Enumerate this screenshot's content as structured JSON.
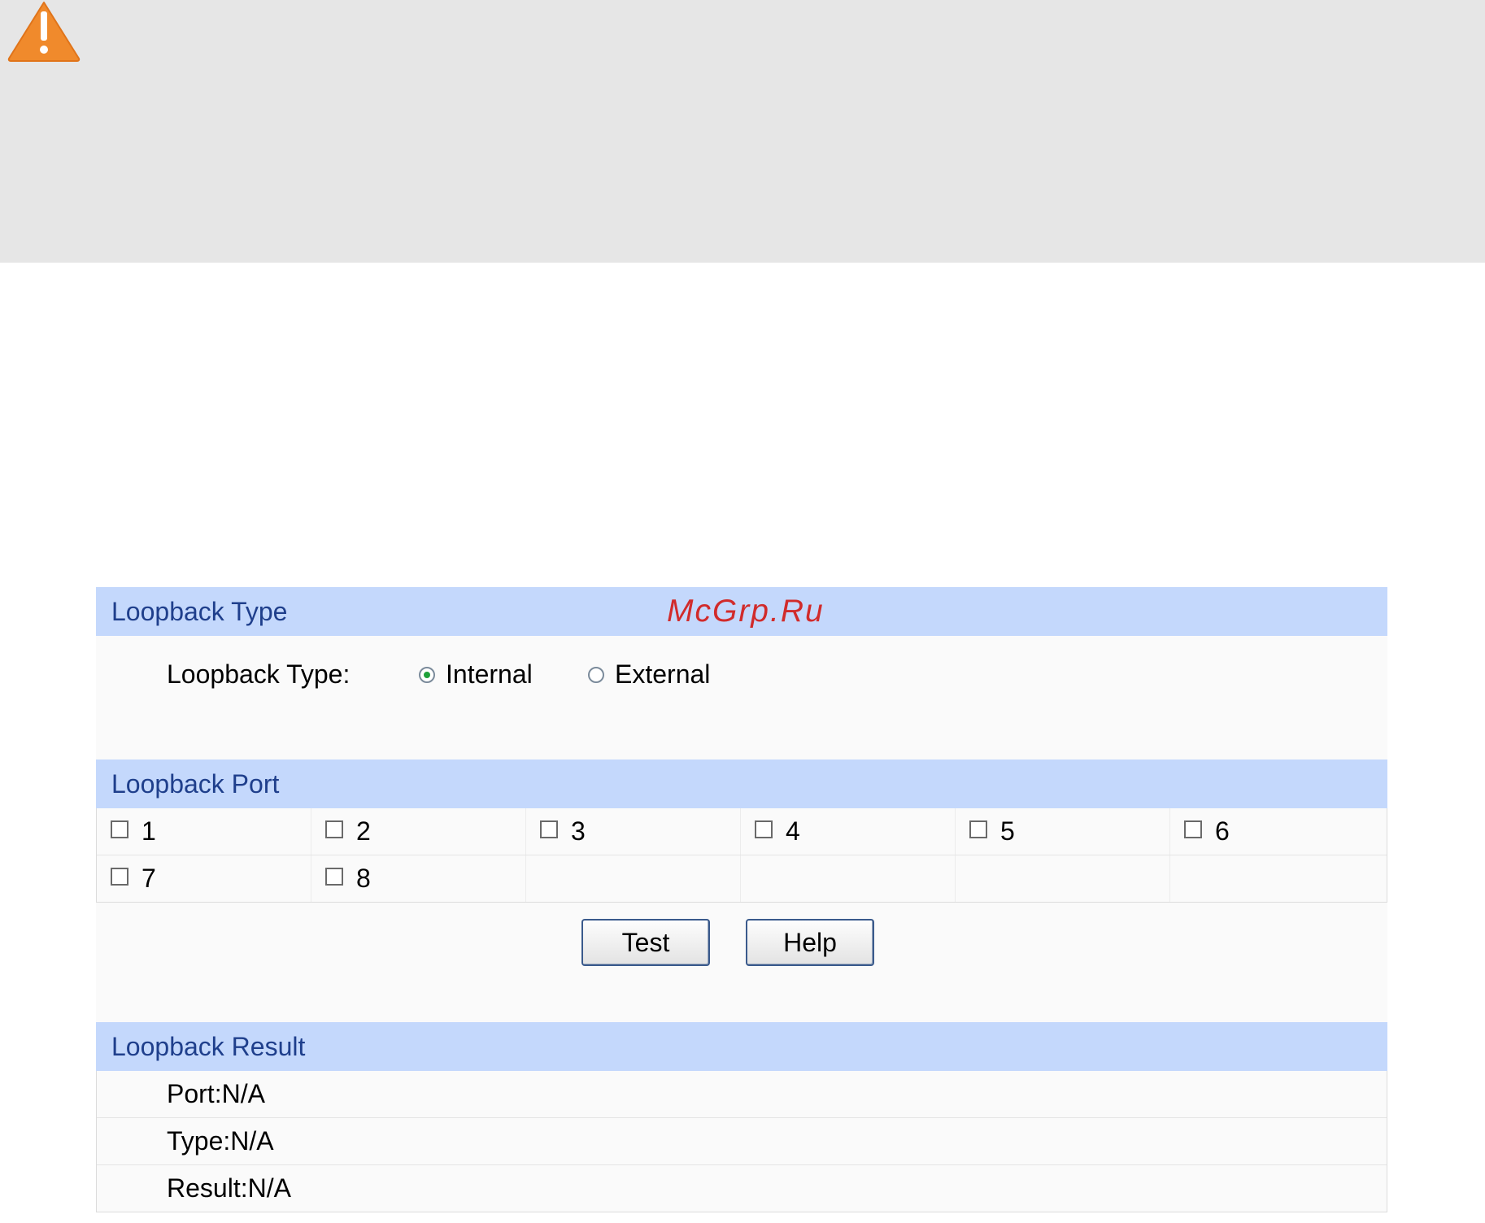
{
  "warning": {
    "icon": "warning-icon",
    "color": "#f08a2c"
  },
  "loopback_type": {
    "section_title": "Loopback Type",
    "watermark": "McGrp.Ru",
    "field_label": "Loopback Type:",
    "options": [
      {
        "label": "Internal",
        "selected": true
      },
      {
        "label": "External",
        "selected": false
      }
    ]
  },
  "loopback_port": {
    "section_title": "Loopback Port",
    "ports": [
      "1",
      "2",
      "3",
      "4",
      "5",
      "6",
      "7",
      "8"
    ]
  },
  "buttons": {
    "test": "Test",
    "help": "Help"
  },
  "loopback_result": {
    "section_title": "Loopback Result",
    "port": "Port:N/A",
    "type": "Type:N/A",
    "result": "Result:N/A"
  },
  "colors": {
    "section_header_bg": "#c4d8fc",
    "section_title_text": "#1f3f8c",
    "watermark": "#d12b2b",
    "notice_band": "#e6e6e6"
  }
}
